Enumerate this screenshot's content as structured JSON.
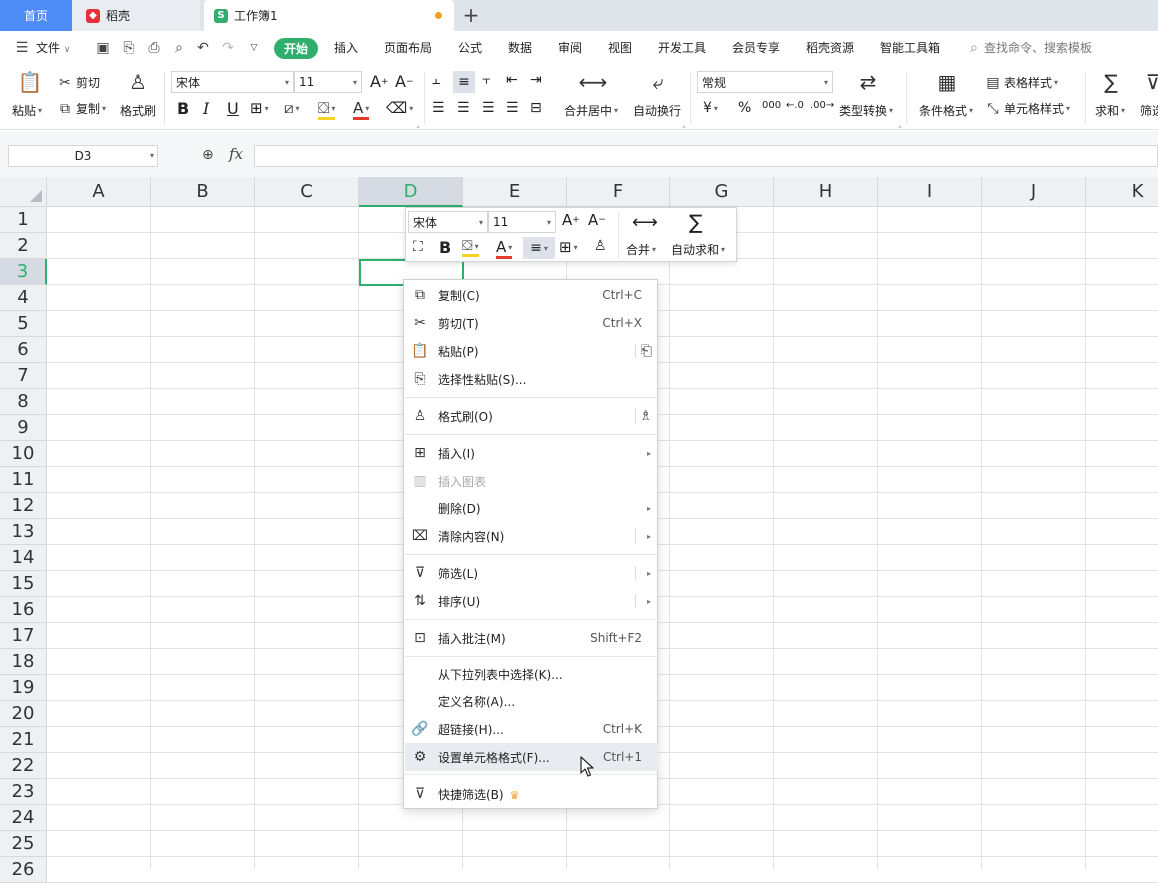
{
  "tabs": {
    "home": "首页",
    "daoke": "稻壳",
    "workbook": "工作簿1"
  },
  "menu": {
    "file": "文件",
    "start": "开始",
    "items": [
      "插入",
      "页面布局",
      "公式",
      "数据",
      "审阅",
      "视图",
      "开发工具",
      "会员专享",
      "稻壳资源",
      "智能工具箱"
    ],
    "search_placeholder": "查找命令、搜索模板"
  },
  "ribbon": {
    "paste": "粘贴",
    "cut": "剪切",
    "copy": "复制",
    "format_painter": "格式刷",
    "font_name": "宋体",
    "font_size": "11",
    "merge_center": "合并居中",
    "wrap": "自动换行",
    "number_format": "常规",
    "type_convert": "类型转换",
    "cond_format": "条件格式",
    "table_style": "表格样式",
    "cell_style": "单元格样式",
    "sum": "求和",
    "filter": "筛选",
    "currency": "¥",
    "percent": "%",
    "thousand": "000"
  },
  "formula_bar": {
    "name_box": "D3",
    "fx": "fx",
    "value": ""
  },
  "grid": {
    "columns": [
      "A",
      "B",
      "C",
      "D",
      "E",
      "F",
      "G",
      "H",
      "I",
      "J",
      "K"
    ],
    "rows": [
      "1",
      "2",
      "3",
      "4",
      "5",
      "6",
      "7",
      "8",
      "9",
      "10",
      "11",
      "12",
      "13",
      "14",
      "15",
      "16",
      "17",
      "18",
      "19",
      "20",
      "21",
      "22",
      "23",
      "24",
      "25",
      "26"
    ],
    "selected_column": "D",
    "selected_row": "3"
  },
  "minibar": {
    "font_name": "宋体",
    "font_size": "11",
    "bold": "B",
    "font_color": "A",
    "merge": "合并",
    "autosum": "自动求和"
  },
  "context_menu": {
    "copy": {
      "label": "复制(C)",
      "shortcut": "Ctrl+C"
    },
    "cut": {
      "label": "剪切(T)",
      "shortcut": "Ctrl+X"
    },
    "paste": {
      "label": "粘贴(P)"
    },
    "paste_special": {
      "label": "选择性粘贴(S)..."
    },
    "format_painter": {
      "label": "格式刷(O)"
    },
    "insert": {
      "label": "插入(I)"
    },
    "insert_chart": {
      "label": "插入图表"
    },
    "delete": {
      "label": "删除(D)"
    },
    "clear": {
      "label": "清除内容(N)"
    },
    "filter": {
      "label": "筛选(L)"
    },
    "sort": {
      "label": "排序(U)"
    },
    "comment": {
      "label": "插入批注(M)",
      "shortcut": "Shift+F2"
    },
    "pick_list": {
      "label": "从下拉列表中选择(K)..."
    },
    "define_name": {
      "label": "定义名称(A)..."
    },
    "hyperlink": {
      "label": "超链接(H)...",
      "shortcut": "Ctrl+K"
    },
    "format_cells": {
      "label": "设置单元格格式(F)...",
      "shortcut": "Ctrl+1"
    },
    "quick_filter": {
      "label": "快捷筛选(B)"
    }
  },
  "colors": {
    "accent_green": "#2fae6e",
    "home_tab_blue": "#4e8cf5",
    "font_red": "#e33b2e",
    "fill_yellow": "#f7d21f"
  }
}
